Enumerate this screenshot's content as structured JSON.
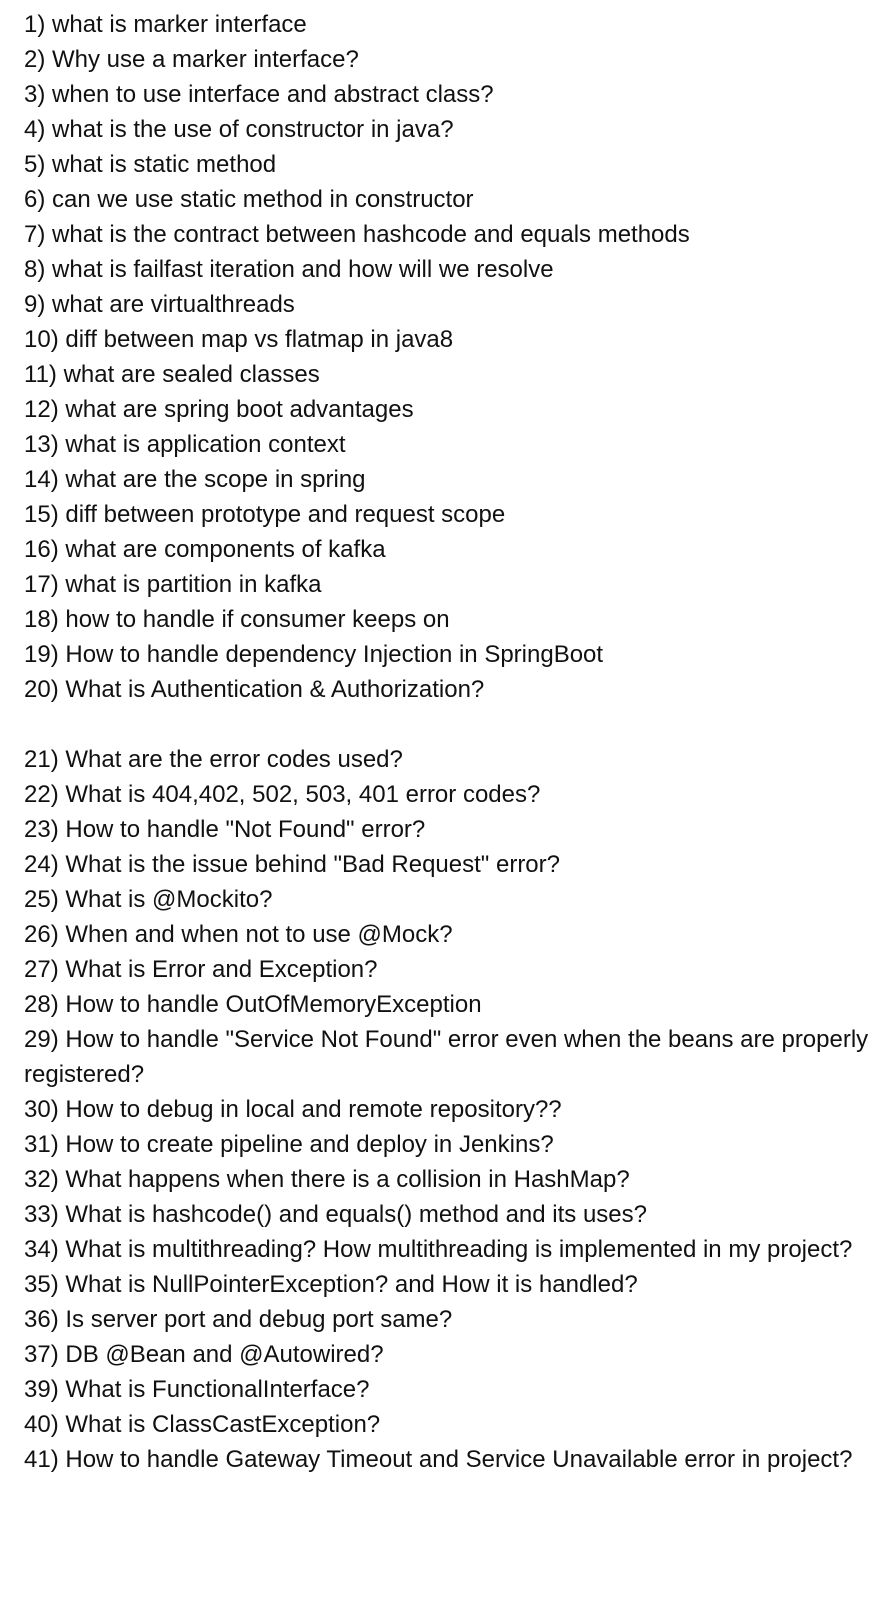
{
  "questions_part1": [
    "1) what is marker interface",
    "2) Why use a marker interface?",
    "3) when to use interface and abstract class?",
    "4) what is the use of constructor in java?",
    "5) what is static method",
    "6) can we use static method in constructor",
    "7) what is the contract between hashcode and equals methods",
    "8) what is failfast iteration and how will we resolve",
    "9) what are virtualthreads",
    "10) diff between map vs flatmap in java8",
    "11) what are sealed classes",
    "12) what are spring boot advantages",
    "13) what is application context",
    "14) what are the scope in spring",
    "15) diff between prototype and request scope",
    "16) what are components of kafka",
    "17) what is partition in kafka",
    "18) how to handle if consumer keeps on",
    "19) How to handle dependency Injection in SpringBoot",
    "20) What is Authentication & Authorization?"
  ],
  "questions_part2": [
    "21) What are the error codes used?",
    "22) What is 404,402, 502, 503, 401 error codes?",
    "23) How to handle \"Not Found\" error?",
    "24) What is the issue behind \"Bad Request\" error?",
    "25) What is @Mockito?",
    "26) When and when not to use @Mock?",
    "27) What is Error and Exception?",
    "28) How to handle OutOfMemoryException",
    "29) How to handle \"Service Not Found\" error even when the beans are properly registered?",
    "30) How to debug in local and remote repository??",
    "31) How to create pipeline and deploy in Jenkins?",
    "32) What happens when there is a collision in HashMap?",
    "33) What is hashcode() and equals() method and its uses?",
    "34) What is multithreading? How multithreading is implemented in my project?",
    "35) What is NullPointerException? and How it is handled?",
    "36) Is server port and debug port same?",
    "37) DB @Bean and @Autowired?",
    "39) What is FunctionalInterface?",
    "40) What is ClassCastException?",
    "41) How to handle Gateway Timeout and Service Unavailable error in project?"
  ]
}
